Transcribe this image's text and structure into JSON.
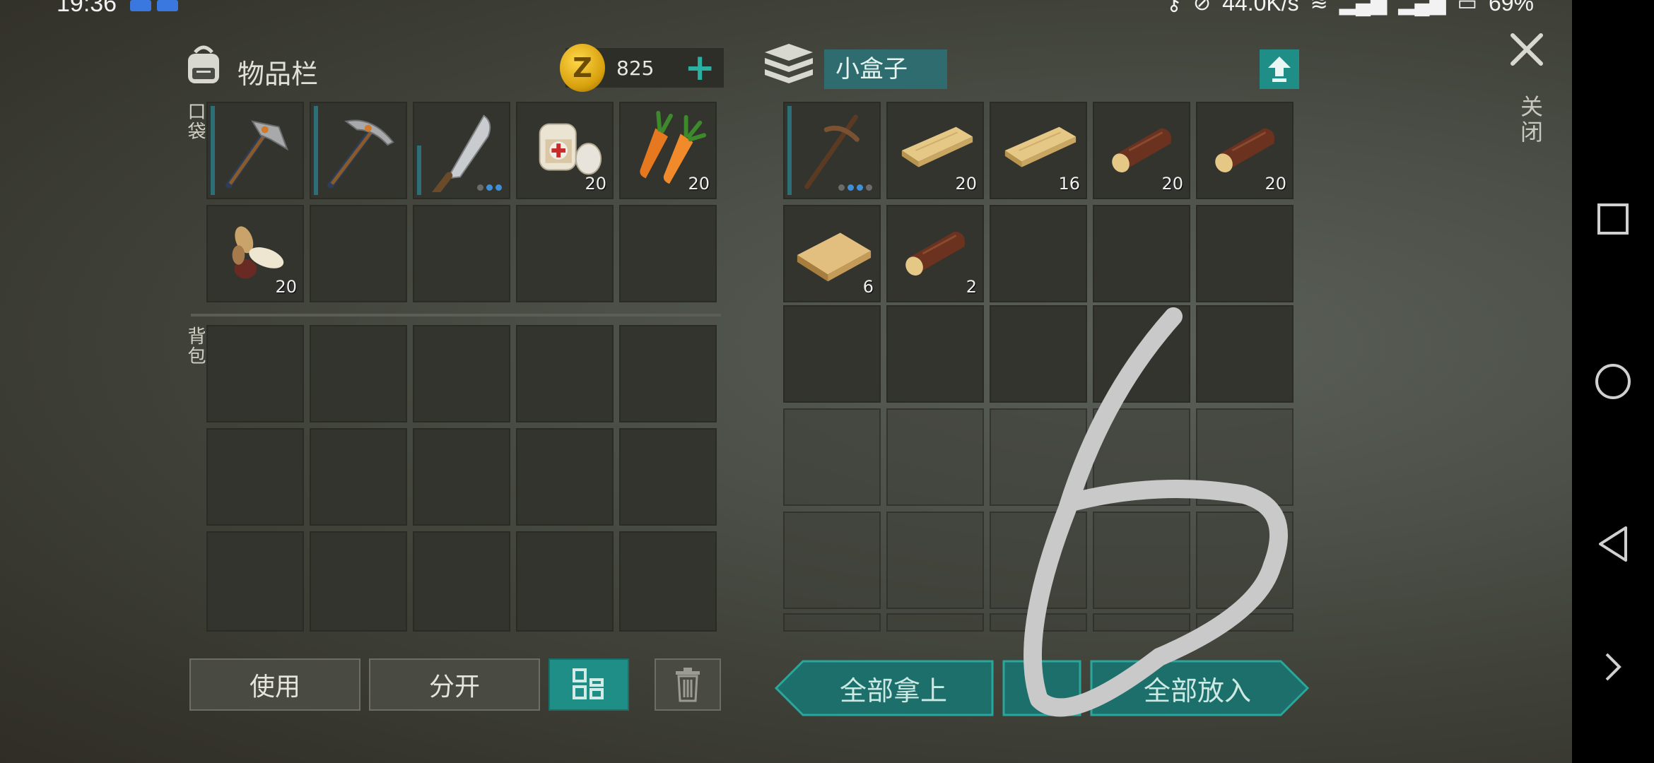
{
  "status_bar": {
    "time": "19:36",
    "network_speed": "44.0K/s",
    "battery": "69%"
  },
  "inventory": {
    "title": "物品栏",
    "coins": "825",
    "add_icon": "plus-icon",
    "pocket_label": "口袋",
    "backpack_label": "背包",
    "pocket_items": [
      {
        "name": "hatchet",
        "count": ""
      },
      {
        "name": "pickaxe",
        "count": ""
      },
      {
        "name": "machete",
        "count": ""
      },
      {
        "name": "bandage",
        "count": "20"
      },
      {
        "name": "carrot",
        "count": "20"
      },
      {
        "name": "seeds",
        "count": "20"
      }
    ]
  },
  "container": {
    "title": "小盒子",
    "close_label": "关闭",
    "items": [
      {
        "name": "wooden-pickaxe",
        "count": ""
      },
      {
        "name": "plank",
        "count": "20"
      },
      {
        "name": "plank",
        "count": "16"
      },
      {
        "name": "log",
        "count": "20"
      },
      {
        "name": "log",
        "count": "20"
      },
      {
        "name": "board",
        "count": "6"
      },
      {
        "name": "log",
        "count": "2"
      }
    ]
  },
  "buttons": {
    "use": "使用",
    "split": "分开",
    "take_all": "全部拿上",
    "put_all": "全部放入"
  },
  "colors": {
    "accent": "#1f8e86",
    "slot": "#33342e",
    "drawing": "#c9c9c9"
  }
}
